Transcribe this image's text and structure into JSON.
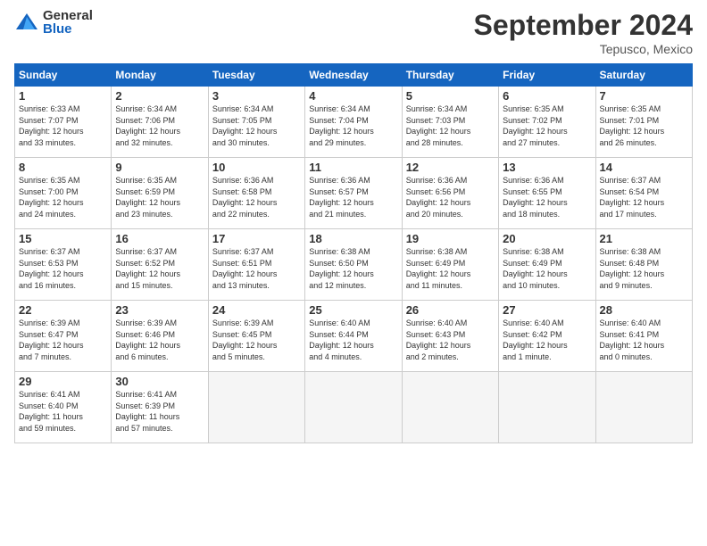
{
  "header": {
    "logo_general": "General",
    "logo_blue": "Blue",
    "month_title": "September 2024",
    "location": "Tepusco, Mexico"
  },
  "weekdays": [
    "Sunday",
    "Monday",
    "Tuesday",
    "Wednesday",
    "Thursday",
    "Friday",
    "Saturday"
  ],
  "weeks": [
    [
      {
        "day": "1",
        "info": "Sunrise: 6:33 AM\nSunset: 7:07 PM\nDaylight: 12 hours\nand 33 minutes."
      },
      {
        "day": "2",
        "info": "Sunrise: 6:34 AM\nSunset: 7:06 PM\nDaylight: 12 hours\nand 32 minutes."
      },
      {
        "day": "3",
        "info": "Sunrise: 6:34 AM\nSunset: 7:05 PM\nDaylight: 12 hours\nand 30 minutes."
      },
      {
        "day": "4",
        "info": "Sunrise: 6:34 AM\nSunset: 7:04 PM\nDaylight: 12 hours\nand 29 minutes."
      },
      {
        "day": "5",
        "info": "Sunrise: 6:34 AM\nSunset: 7:03 PM\nDaylight: 12 hours\nand 28 minutes."
      },
      {
        "day": "6",
        "info": "Sunrise: 6:35 AM\nSunset: 7:02 PM\nDaylight: 12 hours\nand 27 minutes."
      },
      {
        "day": "7",
        "info": "Sunrise: 6:35 AM\nSunset: 7:01 PM\nDaylight: 12 hours\nand 26 minutes."
      }
    ],
    [
      {
        "day": "8",
        "info": "Sunrise: 6:35 AM\nSunset: 7:00 PM\nDaylight: 12 hours\nand 24 minutes."
      },
      {
        "day": "9",
        "info": "Sunrise: 6:35 AM\nSunset: 6:59 PM\nDaylight: 12 hours\nand 23 minutes."
      },
      {
        "day": "10",
        "info": "Sunrise: 6:36 AM\nSunset: 6:58 PM\nDaylight: 12 hours\nand 22 minutes."
      },
      {
        "day": "11",
        "info": "Sunrise: 6:36 AM\nSunset: 6:57 PM\nDaylight: 12 hours\nand 21 minutes."
      },
      {
        "day": "12",
        "info": "Sunrise: 6:36 AM\nSunset: 6:56 PM\nDaylight: 12 hours\nand 20 minutes."
      },
      {
        "day": "13",
        "info": "Sunrise: 6:36 AM\nSunset: 6:55 PM\nDaylight: 12 hours\nand 18 minutes."
      },
      {
        "day": "14",
        "info": "Sunrise: 6:37 AM\nSunset: 6:54 PM\nDaylight: 12 hours\nand 17 minutes."
      }
    ],
    [
      {
        "day": "15",
        "info": "Sunrise: 6:37 AM\nSunset: 6:53 PM\nDaylight: 12 hours\nand 16 minutes."
      },
      {
        "day": "16",
        "info": "Sunrise: 6:37 AM\nSunset: 6:52 PM\nDaylight: 12 hours\nand 15 minutes."
      },
      {
        "day": "17",
        "info": "Sunrise: 6:37 AM\nSunset: 6:51 PM\nDaylight: 12 hours\nand 13 minutes."
      },
      {
        "day": "18",
        "info": "Sunrise: 6:38 AM\nSunset: 6:50 PM\nDaylight: 12 hours\nand 12 minutes."
      },
      {
        "day": "19",
        "info": "Sunrise: 6:38 AM\nSunset: 6:49 PM\nDaylight: 12 hours\nand 11 minutes."
      },
      {
        "day": "20",
        "info": "Sunrise: 6:38 AM\nSunset: 6:49 PM\nDaylight: 12 hours\nand 10 minutes."
      },
      {
        "day": "21",
        "info": "Sunrise: 6:38 AM\nSunset: 6:48 PM\nDaylight: 12 hours\nand 9 minutes."
      }
    ],
    [
      {
        "day": "22",
        "info": "Sunrise: 6:39 AM\nSunset: 6:47 PM\nDaylight: 12 hours\nand 7 minutes."
      },
      {
        "day": "23",
        "info": "Sunrise: 6:39 AM\nSunset: 6:46 PM\nDaylight: 12 hours\nand 6 minutes."
      },
      {
        "day": "24",
        "info": "Sunrise: 6:39 AM\nSunset: 6:45 PM\nDaylight: 12 hours\nand 5 minutes."
      },
      {
        "day": "25",
        "info": "Sunrise: 6:40 AM\nSunset: 6:44 PM\nDaylight: 12 hours\nand 4 minutes."
      },
      {
        "day": "26",
        "info": "Sunrise: 6:40 AM\nSunset: 6:43 PM\nDaylight: 12 hours\nand 2 minutes."
      },
      {
        "day": "27",
        "info": "Sunrise: 6:40 AM\nSunset: 6:42 PM\nDaylight: 12 hours\nand 1 minute."
      },
      {
        "day": "28",
        "info": "Sunrise: 6:40 AM\nSunset: 6:41 PM\nDaylight: 12 hours\nand 0 minutes."
      }
    ],
    [
      {
        "day": "29",
        "info": "Sunrise: 6:41 AM\nSunset: 6:40 PM\nDaylight: 11 hours\nand 59 minutes."
      },
      {
        "day": "30",
        "info": "Sunrise: 6:41 AM\nSunset: 6:39 PM\nDaylight: 11 hours\nand 57 minutes."
      },
      {
        "day": "",
        "info": "",
        "empty": true
      },
      {
        "day": "",
        "info": "",
        "empty": true
      },
      {
        "day": "",
        "info": "",
        "empty": true
      },
      {
        "day": "",
        "info": "",
        "empty": true
      },
      {
        "day": "",
        "info": "",
        "empty": true
      }
    ]
  ]
}
